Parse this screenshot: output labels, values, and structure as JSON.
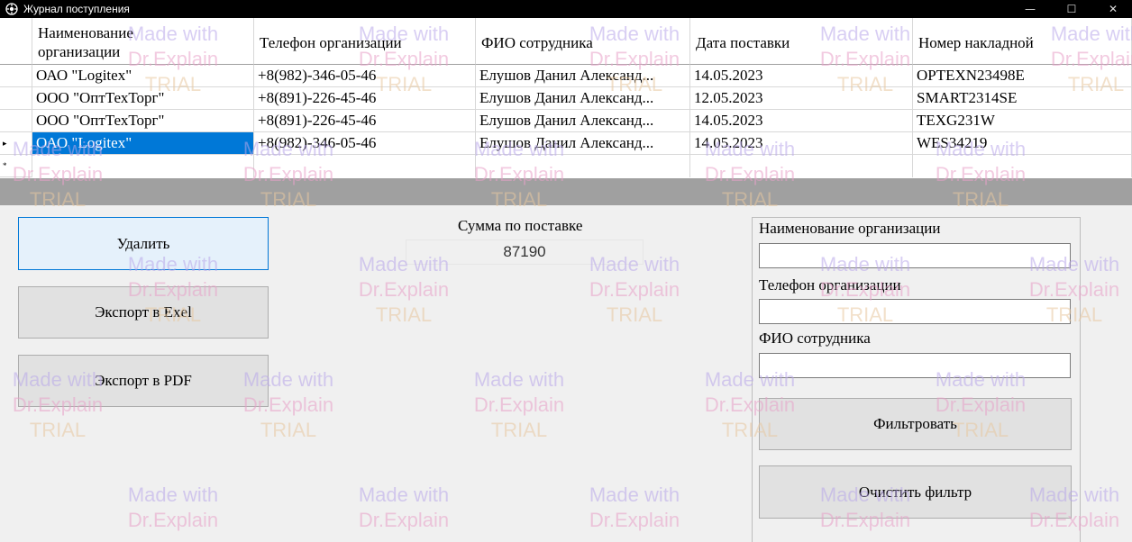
{
  "window": {
    "title": "Журнал поступления",
    "minimize_glyph": "—",
    "maximize_glyph": "☐",
    "close_glyph": "✕"
  },
  "grid": {
    "columns": [
      "Наименование организации",
      "Телефон организации",
      "ФИО сотрудника",
      "Дата поставки",
      "Номер накладной"
    ],
    "rows": [
      {
        "org": "ОАО \"Logitex\"",
        "phone": "+8(982)-346-05-46",
        "fio": "Елушов Данил Александ...",
        "date": "14.05.2023",
        "invoice": "OPTEXN23498E"
      },
      {
        "org": "ООО \"ОптТехТорг\"",
        "phone": "+8(891)-226-45-46",
        "fio": "Елушов Данил Александ...",
        "date": "12.05.2023",
        "invoice": "SMART2314SE"
      },
      {
        "org": "ООО \"ОптТехТорг\"",
        "phone": "+8(891)-226-45-46",
        "fio": "Елушов Данил Александ...",
        "date": "14.05.2023",
        "invoice": "TEXG231W"
      },
      {
        "org": "ОАО \"Logitex\"",
        "phone": "+8(982)-346-05-46",
        "fio": "Елушов Данил Александ...",
        "date": "14.05.2023",
        "invoice": "WES34219"
      }
    ],
    "current_row_marker": "▸",
    "new_row_marker": "*"
  },
  "actions": {
    "delete": "Удалить",
    "export_excel": "Экспорт в Exel",
    "export_pdf": "Экспорт в PDF"
  },
  "summary": {
    "label": "Сумма по поставке",
    "value": "87190"
  },
  "filter": {
    "org_label": "Наименование организации",
    "org_value": "",
    "phone_label": "Телефон организации",
    "phone_value": "",
    "fio_label": "ФИО сотрудника",
    "fio_value": "",
    "apply": "Фильтровать",
    "clear": "Очистить фильтр"
  },
  "watermark": {
    "line1": "Made with",
    "line2": "Dr.Explain",
    "line3": "TRIAL"
  },
  "colors": {
    "selection": "#0078d7",
    "splitter": "#a0a0a0",
    "titlebar": "#000000"
  }
}
